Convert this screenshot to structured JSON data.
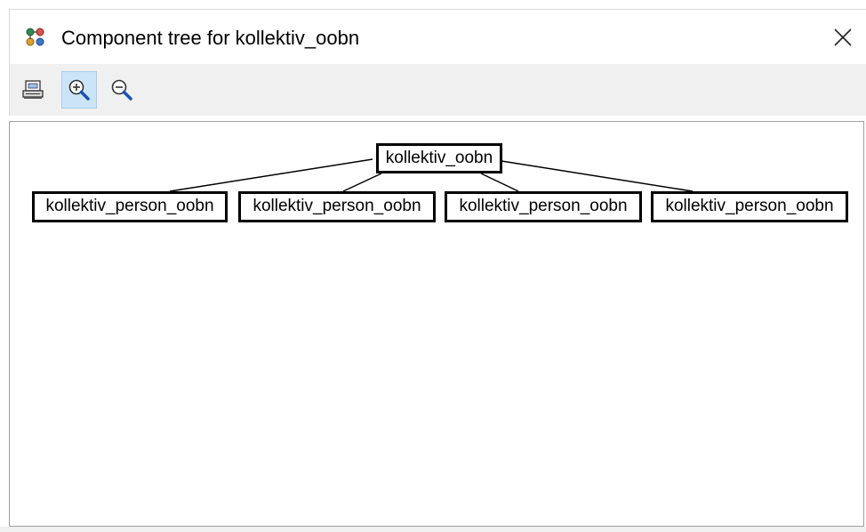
{
  "window": {
    "title": "Component tree for kollektiv_oobn",
    "close_glyph": "✕"
  },
  "toolbar": {
    "buttons": [
      {
        "name": "print-icon",
        "active": false
      },
      {
        "name": "zoom-in-icon",
        "active": true
      },
      {
        "name": "zoom-out-icon",
        "active": false
      }
    ]
  },
  "tree": {
    "root": {
      "label": "kollektiv_oobn"
    },
    "children": [
      {
        "label": "kollektiv_person_oobn"
      },
      {
        "label": "kollektiv_person_oobn"
      },
      {
        "label": "kollektiv_person_oobn"
      },
      {
        "label": "kollektiv_person_oobn"
      }
    ]
  },
  "colors": {
    "toolbar_bg": "#f0f0f0",
    "active_tool_bg": "#cce4f7",
    "node_border": "#000000"
  }
}
